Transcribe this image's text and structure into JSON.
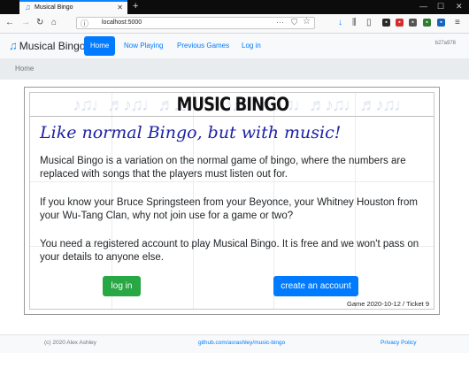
{
  "browser": {
    "tab_title": "Musical Bingo",
    "url": "localhost:5000"
  },
  "site": {
    "brand": "Musical Bingo",
    "nav": [
      "Home",
      "Now Playing",
      "Previous Games",
      "Log in"
    ],
    "build": "b27a978",
    "breadcrumb": "Home"
  },
  "card": {
    "title": "MUSIC BINGO",
    "tagline": "Like normal Bingo, but with music!",
    "paragraphs": [
      "Musical Bingo is a variation on the normal game of bingo, where the numbers are replaced with songs that the players must listen out for.",
      "If you know your Bruce Springsteen from your Beyonce, your Whitney Houston from your Wu-Tang Clan, why not join use for a game or two?",
      "You need a registered account to play Musical Bingo. It is free and we won't pass on your details to anyone else."
    ],
    "login_button": "log in",
    "create_button": "create an account",
    "game_info": "Game 2020-10-12 / Ticket 9"
  },
  "footer": {
    "copyright": "(c) 2020 Alex Ashley",
    "repo": "github.com/asrashley/music-bingo",
    "privacy": "Privacy Policy"
  },
  "colors": {
    "accent": "#007bff",
    "success": "#28a745",
    "tagline": "#1d22a6"
  }
}
